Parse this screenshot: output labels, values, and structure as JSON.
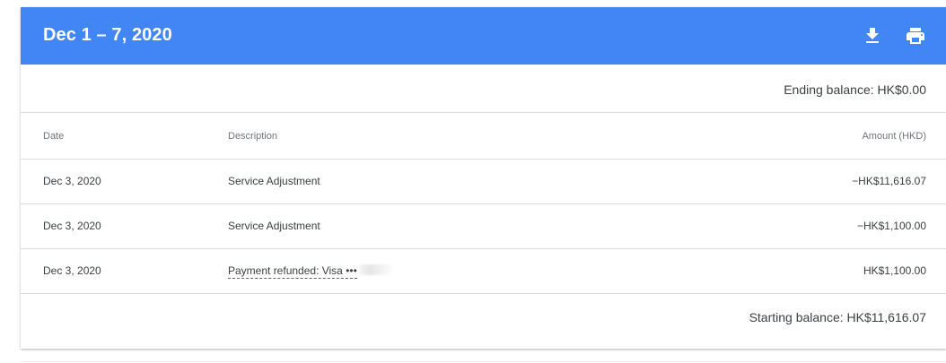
{
  "header": {
    "title": "Dec 1 – 7, 2020",
    "background_color": "#4285f4",
    "download_icon": "download-icon",
    "print_icon": "print-icon"
  },
  "summary": {
    "ending_balance": "Ending balance: HK$0.00",
    "starting_balance": "Starting balance: HK$11,616.07"
  },
  "table": {
    "columns": {
      "date": "Date",
      "description": "Description",
      "amount": "Amount (HKD)"
    },
    "rows": [
      {
        "date": "Dec 3, 2020",
        "description": "Service Adjustment",
        "amount": "−HK$11,616.07"
      },
      {
        "date": "Dec 3, 2020",
        "description": "Service Adjustment",
        "amount": "−HK$1,100.00"
      },
      {
        "date": "Dec 3, 2020",
        "description": "Payment refunded: Visa •••",
        "amount": "HK$1,100.00"
      }
    ]
  }
}
